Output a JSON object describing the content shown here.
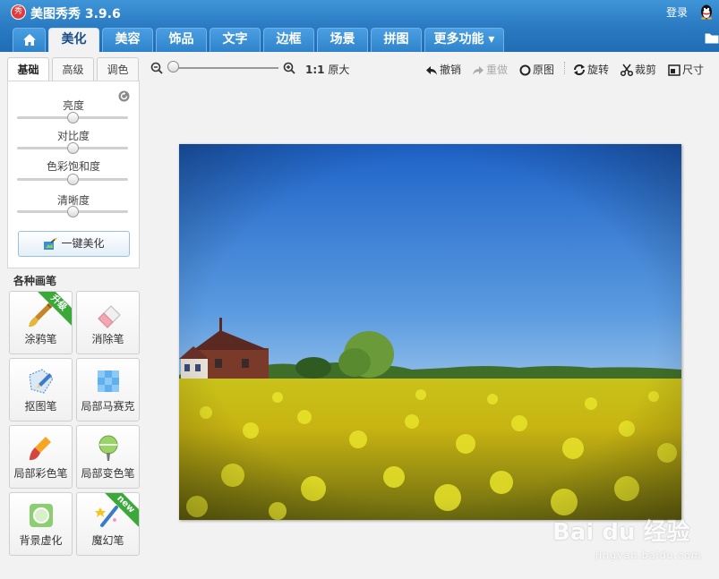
{
  "app": {
    "title": "美图秀秀 3.9.6",
    "logo_text": "秀",
    "login": "登录"
  },
  "nav": {
    "tabs": [
      "美化",
      "美容",
      "饰品",
      "文字",
      "边框",
      "场景",
      "拼图",
      "更多功能 ▾"
    ],
    "active_index": 0
  },
  "left": {
    "sub_tabs": [
      "基础",
      "高级",
      "调色"
    ],
    "sliders": [
      {
        "label": "亮度",
        "value": 0.5
      },
      {
        "label": "对比度",
        "value": 0.5
      },
      {
        "label": "色彩饱和度",
        "value": 0.5
      },
      {
        "label": "清晰度",
        "value": 0.5
      }
    ],
    "onekey_button": "一键美化",
    "brush_heading": "各种画笔",
    "tools": [
      {
        "label": "涂鸦笔",
        "badge": "升级"
      },
      {
        "label": "消除笔",
        "badge": ""
      },
      {
        "label": "抠图笔",
        "badge": ""
      },
      {
        "label": "局部马赛克",
        "badge": ""
      },
      {
        "label": "局部彩色笔",
        "badge": ""
      },
      {
        "label": "局部变色笔",
        "badge": ""
      },
      {
        "label": "背景虚化",
        "badge": ""
      },
      {
        "label": "魔幻笔",
        "badge": "new"
      }
    ]
  },
  "toolbar": {
    "zoom_ratio": "1:1",
    "original_size": "原大",
    "undo": "撤销",
    "redo": "重做",
    "original": "原图",
    "rotate": "旋转",
    "crop": "裁剪",
    "size": "尺寸"
  },
  "watermark": {
    "main": "Bai du 经验",
    "sub": "jingyan.baidu.com"
  },
  "colors": {
    "titlebar": "#2b7cc3",
    "badge_green": "#3aa93a"
  }
}
